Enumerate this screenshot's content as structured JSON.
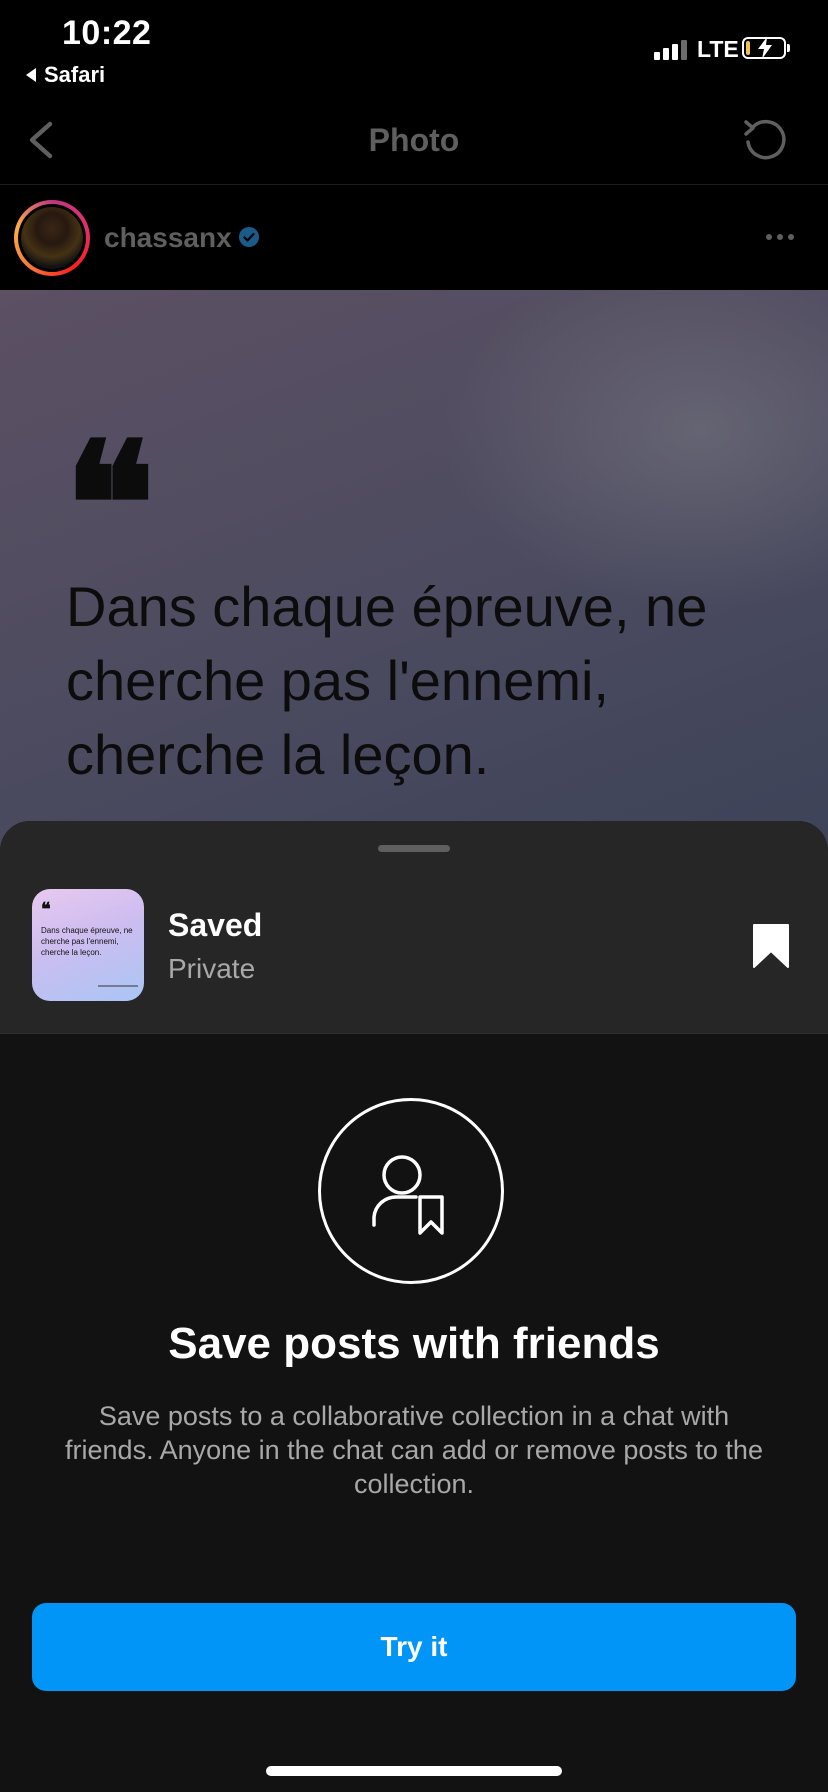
{
  "status_bar": {
    "time": "10:22",
    "back_app": "Safari",
    "network": "LTE",
    "battery_color": "#f2c34a"
  },
  "nav": {
    "title": "Photo",
    "back_icon": "chevron-left-icon",
    "refresh_icon": "refresh-icon"
  },
  "post": {
    "username": "chassanx",
    "verified": true,
    "quote_mark": "❝",
    "quote_text": "Dans chaque épreuve, ne cherche pas l'ennemi, cherche la leçon."
  },
  "sheet": {
    "thumbnail_quote_mark": "❝",
    "thumbnail_text": "Dans chaque épreuve, ne cherche pas l'ennemi, cherche la leçon.",
    "saved_title": "Saved",
    "saved_subtitle": "Private",
    "bookmark_icon": "bookmark-filled-icon",
    "feature_icon": "person-bookmark-icon",
    "feature_title": "Save posts with friends",
    "feature_description": "Save posts to a collaborative collection in a chat with friends. Anyone in the chat can add or remove posts to the collection.",
    "cta_label": "Try it",
    "cta_color": "#0095f6"
  }
}
